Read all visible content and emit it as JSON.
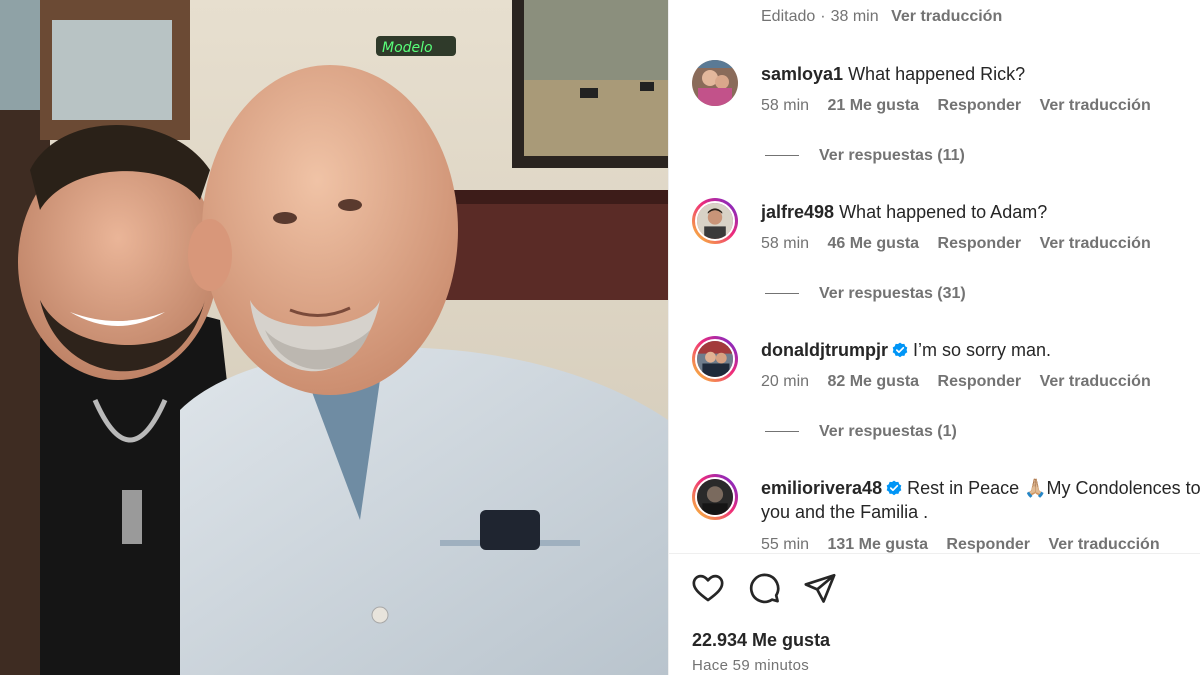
{
  "post": {
    "caption_meta": {
      "edited": "Editado",
      "time": "38 min",
      "translate": "Ver traducción"
    },
    "likes_label": "22.934 Me gusta",
    "time_ago": "Hace 59 minutos"
  },
  "comments": [
    {
      "username": "samloya1",
      "verified": false,
      "text": "What happened Rick?",
      "time": "58 min",
      "likes": "21 Me gusta",
      "reply": "Responder",
      "translate": "Ver traducción",
      "replies": "Ver respuestas (11)"
    },
    {
      "username": "jalfre498",
      "verified": false,
      "text": "What happened to Adam?",
      "time": "58 min",
      "likes": "46 Me gusta",
      "reply": "Responder",
      "translate": "Ver traducción",
      "replies": "Ver respuestas (31)"
    },
    {
      "username": "donaldjtrumpjr",
      "verified": true,
      "text": "I’m so sorry man.",
      "time": "20 min",
      "likes": "82 Me gusta",
      "reply": "Responder",
      "translate": "Ver traducción",
      "replies": "Ver respuestas (1)"
    },
    {
      "username": "emiliorivera48",
      "verified": true,
      "text": "Rest in Peace 🙏🏼My Condolences to you and the Familia .",
      "time": "55 min",
      "likes": "131 Me gusta",
      "reply": "Responder",
      "translate": "Ver traducción"
    }
  ],
  "actions": {
    "like": "heart-icon",
    "comment": "comment-icon",
    "share": "share-icon"
  },
  "colors": {
    "verified": "#0095f6",
    "story_ring": "#ee2a7b",
    "muted": "#737373"
  }
}
